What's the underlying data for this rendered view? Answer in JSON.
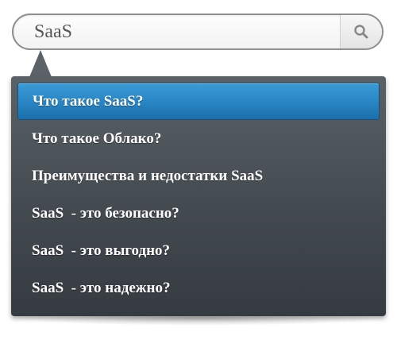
{
  "search": {
    "value": "SaaS",
    "button_icon": "search-icon"
  },
  "suggestions": {
    "items": [
      {
        "label": "Что такое SaaS?",
        "active": true
      },
      {
        "label": "Что такое Облако?",
        "active": false
      },
      {
        "label": "Преимущества и недостатки SaaS",
        "active": false
      },
      {
        "label": "SaaS  - это безопасно?",
        "active": false
      },
      {
        "label": "SaaS  - это выгодно?",
        "active": false
      },
      {
        "label": "SaaS  - это надежно?",
        "active": false
      }
    ]
  },
  "colors": {
    "active_item": "#2a86c5",
    "dropdown_bg": "#434a50",
    "item_text": "#ffffff"
  }
}
